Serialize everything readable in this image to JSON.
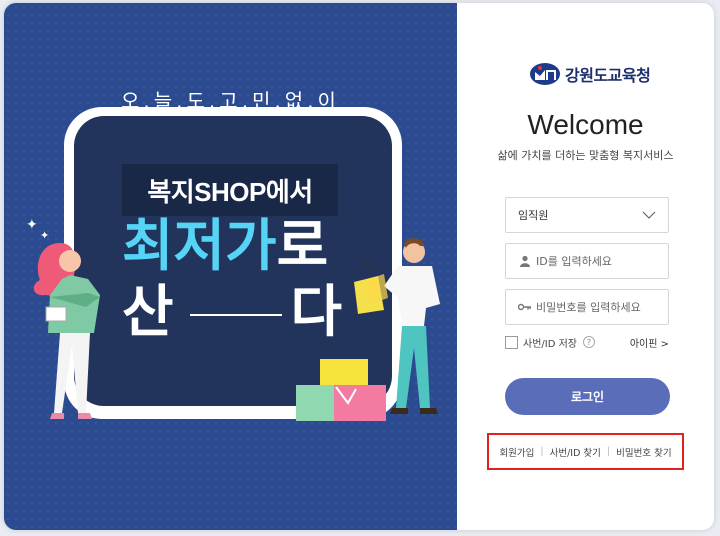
{
  "banner": {
    "slogan": "오.늘.도.고.민.없.이",
    "title": "복지SHOP에서",
    "headline_part1": "최저",
    "headline_part2": "가",
    "headline_part3": "로",
    "bottom_left": "산",
    "bottom_right": "다"
  },
  "panel": {
    "logo_text": "강원도교육청",
    "welcome": "Welcome",
    "subtitle": "삶에 가치를 더하는 맞춤형 복지서비스",
    "user_type": {
      "selected": "임직원"
    },
    "id_field": {
      "placeholder": "ID를 입력하세요"
    },
    "pw_field": {
      "placeholder": "비밀번호를 입력하세요"
    },
    "save_id_label": "사번/ID 저장",
    "help_glyph": "?",
    "ipin_label": "아이핀 >",
    "login_label": "로그인",
    "links": {
      "signup": "회원가입",
      "find_id": "사번/ID 찾기",
      "find_pw": "비밀번호 찾기",
      "separator": "|"
    }
  },
  "colors": {
    "banner_bg": "#2b4a8f",
    "board": "#22335c",
    "highlight": "#55d4f6",
    "login_button": "#5a6db8",
    "links_border": "#e0211e"
  }
}
